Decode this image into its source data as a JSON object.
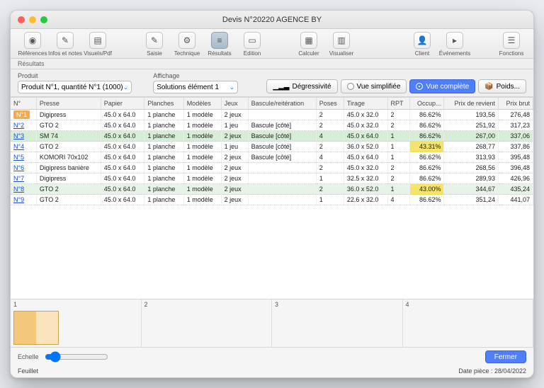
{
  "window": {
    "title": "Devis N°20220 AGENCE BY"
  },
  "toolbar": {
    "left": [
      {
        "label": "Références",
        "glyph": "◉"
      },
      {
        "label": "Infos et notes",
        "glyph": "✎"
      },
      {
        "label": "Visuels/Pdf",
        "glyph": "▤"
      }
    ],
    "mid": [
      {
        "label": "Saisie",
        "glyph": "✎"
      },
      {
        "label": "Technique",
        "glyph": "⚙"
      },
      {
        "label": "Résultats",
        "glyph": "≡",
        "active": true
      },
      {
        "label": "Edition",
        "glyph": "▭"
      }
    ],
    "calc": [
      {
        "label": "Calculer",
        "glyph": "▦"
      },
      {
        "label": "Visualiser",
        "glyph": "▥"
      }
    ],
    "right": [
      {
        "label": "Client",
        "glyph": "👤"
      },
      {
        "label": "Événements",
        "glyph": "▸"
      }
    ],
    "far": [
      {
        "label": "Fonctions",
        "glyph": "☰"
      }
    ]
  },
  "subheader": "Résultats",
  "filters": {
    "produit_label": "Produit",
    "produit_value": "Produit N°1, quantité N°1 (1000)",
    "affichage_label": "Affichage",
    "affichage_value": "Solutions élément 1",
    "degressivite": "Dégressivité",
    "vue_simplifiee": "Vue simplifiée",
    "vue_complete": "Vue complète",
    "poids": "Poids..."
  },
  "columns": [
    "N°",
    "Presse",
    "Papier",
    "Planches",
    "Modèles",
    "Jeux",
    "Bascule/reitération",
    "Poses",
    "Tirage",
    "RPT",
    "Occup...",
    "Prix de revient",
    "Prix brut"
  ],
  "rows": [
    {
      "n": "N°1",
      "presse": "Digipress",
      "papier": "45.0 x 64.0",
      "planches": "1 planche",
      "modeles": "1 modèle",
      "jeux": "2 jeux",
      "bascule": "",
      "poses": "2",
      "tirage": "45.0 x 32.0",
      "rpt": "2",
      "occup": "86.62%",
      "revient": "193,56",
      "brut": "276,48",
      "first": true
    },
    {
      "n": "N°2",
      "presse": "GTO 2",
      "papier": "45.0 x 64.0",
      "planches": "1 planche",
      "modeles": "1 modèle",
      "jeux": "1 jeu",
      "bascule": "Bascule [côté]",
      "poses": "2",
      "tirage": "45.0 x 32.0",
      "rpt": "2",
      "occup": "86.62%",
      "revient": "251,92",
      "brut": "317,23"
    },
    {
      "n": "N°3",
      "presse": "SM 74",
      "papier": "45.0 x 64.0",
      "planches": "1 planche",
      "modeles": "1 modèle",
      "jeux": "2 jeux",
      "bascule": "Bascule [côté]",
      "poses": "4",
      "tirage": "45.0 x 64.0",
      "rpt": "1",
      "occup": "86.62%",
      "revient": "267,00",
      "brut": "337,06",
      "sel": true
    },
    {
      "n": "N°4",
      "presse": "GTO 2",
      "papier": "45.0 x 64.0",
      "planches": "1 planche",
      "modeles": "1 modèle",
      "jeux": "1 jeu",
      "bascule": "Bascule [côté]",
      "poses": "2",
      "tirage": "36.0 x 52.0",
      "rpt": "1",
      "occup": "43.31%",
      "revient": "268,77",
      "brut": "337,86",
      "hl": true
    },
    {
      "n": "N°5",
      "presse": "KOMORI 70x102",
      "papier": "45.0 x 64.0",
      "planches": "1 planche",
      "modeles": "1 modèle",
      "jeux": "2 jeux",
      "bascule": "Bascule [côté]",
      "poses": "4",
      "tirage": "45.0 x 64.0",
      "rpt": "1",
      "occup": "86.62%",
      "revient": "313,93",
      "brut": "395,48"
    },
    {
      "n": "N°6",
      "presse": "Digipress banière",
      "papier": "45.0 x 64.0",
      "planches": "1 planche",
      "modeles": "1 modèle",
      "jeux": "2 jeux",
      "bascule": "",
      "poses": "2",
      "tirage": "45.0 x 32.0",
      "rpt": "2",
      "occup": "86.62%",
      "revient": "268,56",
      "brut": "396,48"
    },
    {
      "n": "N°7",
      "presse": "Digipress",
      "papier": "45.0 x 64.0",
      "planches": "1 planche",
      "modeles": "1 modèle",
      "jeux": "2 jeux",
      "bascule": "",
      "poses": "1",
      "tirage": "32.5 x 32.0",
      "rpt": "2",
      "occup": "86.62%",
      "revient": "289,93",
      "brut": "426,96"
    },
    {
      "n": "N°8",
      "presse": "GTO 2",
      "papier": "45.0 x 64.0",
      "planches": "1 planche",
      "modeles": "1 modèle",
      "jeux": "2 jeux",
      "bascule": "",
      "poses": "2",
      "tirage": "36.0 x 52.0",
      "rpt": "1",
      "occup": "43.00%",
      "revient": "344,67",
      "brut": "435,24",
      "sel2": true,
      "hl": true
    },
    {
      "n": "N°9",
      "presse": "GTO 2",
      "papier": "45.0 x 64.0",
      "planches": "1 planche",
      "modeles": "1 modèle",
      "jeux": "2 jeux",
      "bascule": "",
      "poses": "1",
      "tirage": "22.6 x 32.0",
      "rpt": "4",
      "occup": "86.62%",
      "revient": "351,24",
      "brut": "441,07"
    }
  ],
  "thumbs": [
    "1",
    "2",
    "3",
    "4"
  ],
  "echelle": "Echelle",
  "fermer": "Fermer",
  "footer_left": "Feuillet",
  "footer_right": "Date pièce : 28/04/2022"
}
